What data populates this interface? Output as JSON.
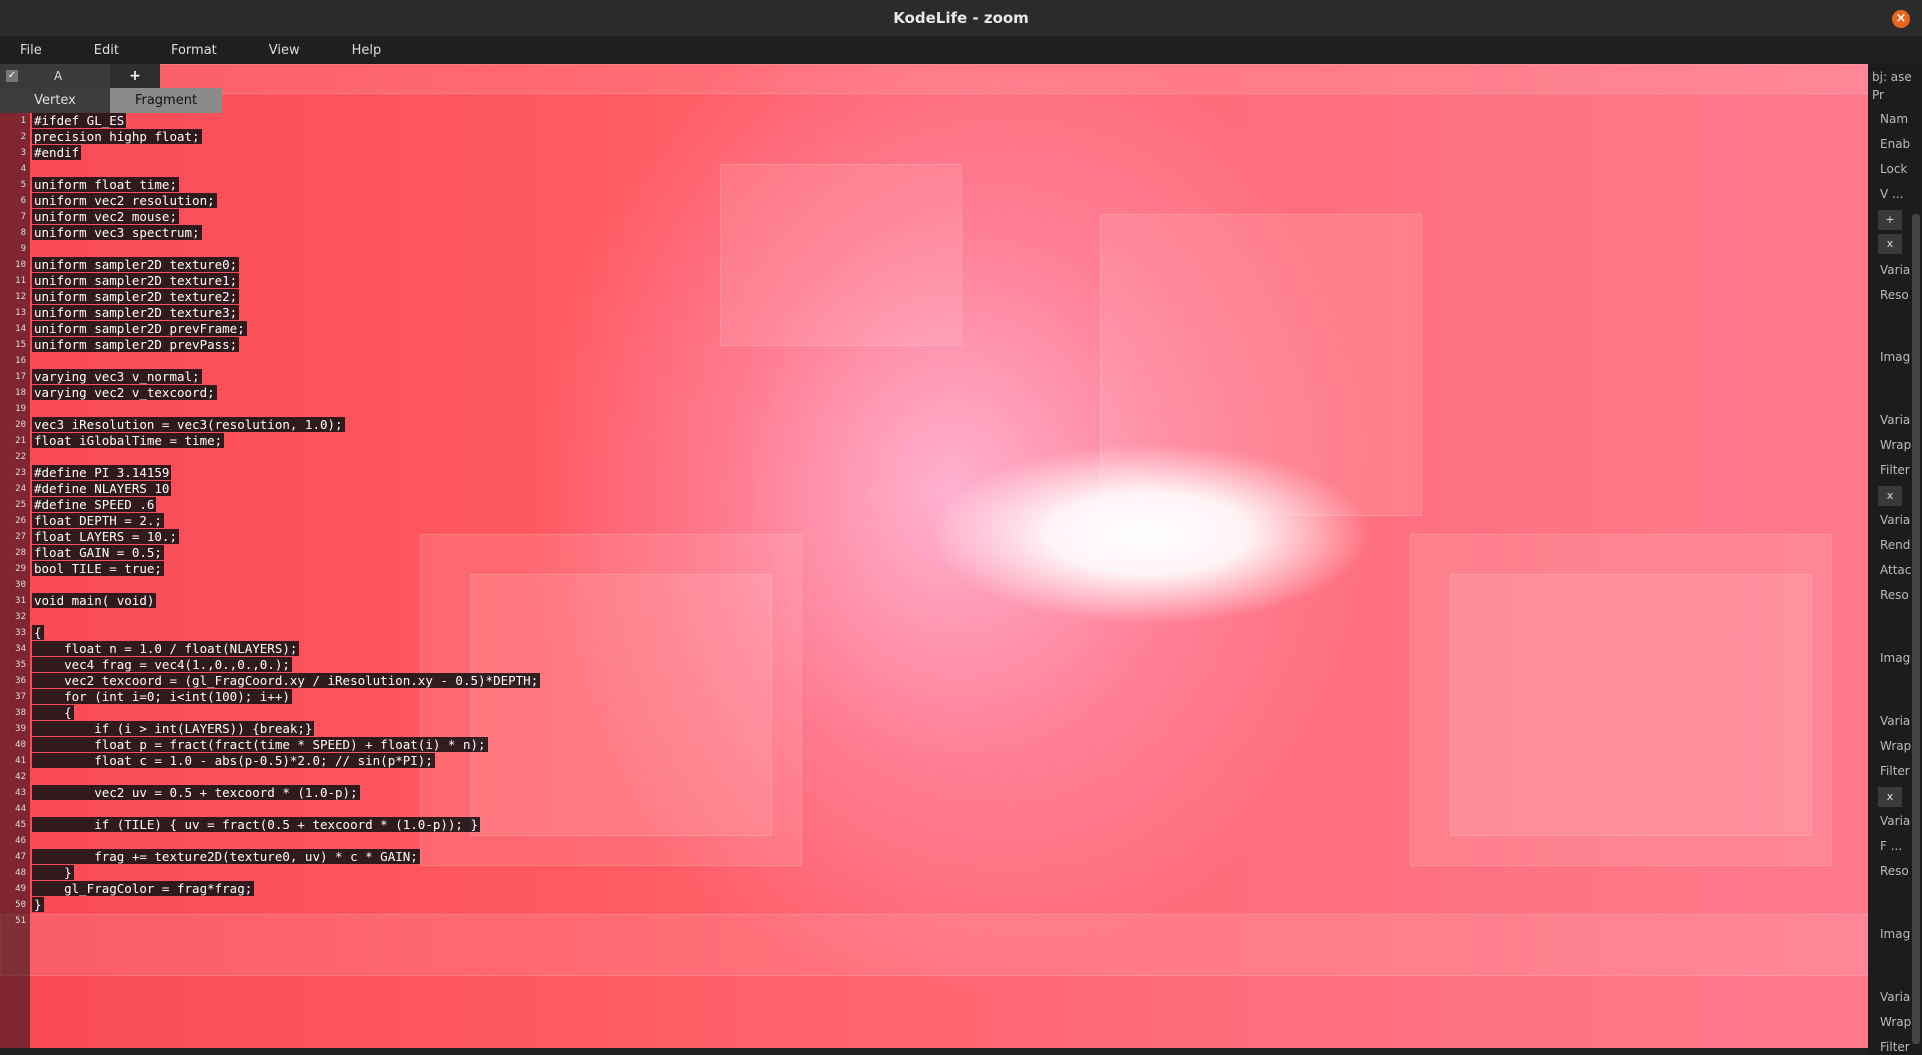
{
  "window": {
    "title": "KodeLife - zoom"
  },
  "menu": [
    "File",
    "Edit",
    "Format",
    "View",
    "Help"
  ],
  "tabs": {
    "pass_label": "A",
    "add_label": "+"
  },
  "shader_tabs": [
    "Vertex",
    "Fragment"
  ],
  "editor": {
    "lines": [
      "#ifdef GL_ES",
      "precision highp float;",
      "#endif",
      "",
      "uniform float time;",
      "uniform vec2 resolution;",
      "uniform vec2 mouse;",
      "uniform vec3 spectrum;",
      "",
      "uniform sampler2D texture0;",
      "uniform sampler2D texture1;",
      "uniform sampler2D texture2;",
      "uniform sampler2D texture3;",
      "uniform sampler2D prevFrame;",
      "uniform sampler2D prevPass;",
      "",
      "varying vec3 v_normal;",
      "varying vec2 v_texcoord;",
      "",
      "vec3 iResolution = vec3(resolution, 1.0);",
      "float iGlobalTime = time;",
      "",
      "#define PI 3.14159",
      "#define NLAYERS 10",
      "#define SPEED .6",
      "float DEPTH = 2.;",
      "float LAYERS = 10.;",
      "float GAIN = 0.5;",
      "bool TILE = true;",
      "",
      "void main( void)",
      "",
      "{",
      "    float n = 1.0 / float(NLAYERS);",
      "    vec4 frag = vec4(1.,0.,0.,0.);",
      "    vec2 texcoord = (gl_FragCoord.xy / iResolution.xy - 0.5)*DEPTH;",
      "    for (int i=0; i<int(100); i++)",
      "    {",
      "        if (i > int(LAYERS)) {break;}",
      "        float p = fract(fract(time * SPEED) + float(i) * n);",
      "        float c = 1.0 - abs(p-0.5)*2.0; // sin(p*PI);",
      "",
      "        vec2 uv = 0.5 + texcoord * (1.0-p);",
      "",
      "        if (TILE) { uv = fract(0.5 + texcoord * (1.0-p)); }",
      "",
      "        frag += texture2D(texture0, uv) * c * GAIN;",
      "    }",
      "    gl_FragColor = frag*frag;",
      "}",
      ""
    ]
  },
  "properties_panel": {
    "labels": [
      "Pr",
      "Nam",
      "Enab",
      "Lock",
      "V ...",
      "Varia",
      "Reso",
      "Imag",
      "Varia",
      "Wrap",
      "Filter",
      "Varia",
      "Rend",
      "Attac",
      "Reso",
      "Imag",
      "Varia",
      "Wrap",
      "Filter",
      "Varia",
      "F ...",
      "Reso",
      "Imag",
      "Varia",
      "Wrap",
      "Filter"
    ],
    "add_label": "+",
    "remove_label": "x",
    "header_label": "bj: ase"
  },
  "colors": {
    "accent_close": "#e8651a",
    "code_bg": "#141216",
    "viewport_red": "#ff5a62"
  }
}
